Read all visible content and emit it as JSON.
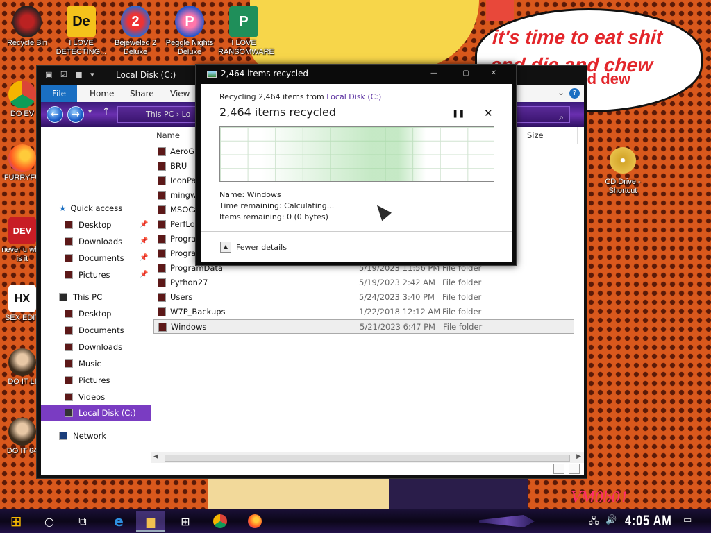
{
  "wallpaper": {
    "speech": "it's time to eat shit and die and chew",
    "speech_overflow": "and dew",
    "watermark": "VM0b01"
  },
  "desktop_icons": [
    {
      "label": "Recycle Bin",
      "icon": "recycle-bin-icon"
    },
    {
      "label": "I LOVE DETECTING...",
      "icon": "app-de-icon"
    },
    {
      "label": "Bejeweled 2 Deluxe",
      "icon": "bejeweled-icon"
    },
    {
      "label": "Peggle Nights Deluxe",
      "icon": "peggle-icon"
    },
    {
      "label": "I LOVE RANSOMWARE",
      "icon": "publisher-icon"
    },
    {
      "label": "DO EV",
      "icon": "chrome-icon"
    },
    {
      "label": "FURRYFU",
      "icon": "firefox-icon"
    },
    {
      "label": "never u why is it",
      "icon": "devcpp-icon"
    },
    {
      "label": "SEX EDIT",
      "icon": "hex-editor-icon"
    },
    {
      "label": "DO IT LI",
      "icon": "portrait-icon"
    },
    {
      "label": "DO IT 64",
      "icon": "portrait-64-icon"
    },
    {
      "label": "CD Drive - Shortcut",
      "icon": "dvd-icon"
    }
  ],
  "explorer": {
    "title": "Local Disk (C:)",
    "ribbon_tabs": [
      "File",
      "Home",
      "Share",
      "View"
    ],
    "help": "?",
    "breadcrumb": "This PC  ›  Lo",
    "nav": {
      "quick_access": "Quick access",
      "quick_items": [
        "Desktop",
        "Downloads",
        "Documents",
        "Pictures"
      ],
      "this_pc": "This PC",
      "pc_items": [
        "Desktop",
        "Documents",
        "Downloads",
        "Music",
        "Pictures",
        "Videos"
      ],
      "selected": "Local Disk (C:)",
      "network": "Network"
    },
    "columns": {
      "name": "Name",
      "size": "Size"
    },
    "files": [
      {
        "name": "AeroGla",
        "date": "",
        "type": ""
      },
      {
        "name": "BRU",
        "date": "",
        "type": ""
      },
      {
        "name": "IconPac",
        "date": "",
        "type": ""
      },
      {
        "name": "mingw6",
        "date": "",
        "type": ""
      },
      {
        "name": "MSOCac",
        "date": "",
        "type": ""
      },
      {
        "name": "PerfLog",
        "date": "",
        "type": ""
      },
      {
        "name": "Progran",
        "date": "",
        "type": ""
      },
      {
        "name": "Progran",
        "date": "",
        "type": ""
      },
      {
        "name": "ProgramData",
        "date": "5/19/2023 11:56 PM",
        "type": "File folder"
      },
      {
        "name": "Python27",
        "date": "5/19/2023 2:42 AM",
        "type": "File folder"
      },
      {
        "name": "Users",
        "date": "5/24/2023 3:40 PM",
        "type": "File folder"
      },
      {
        "name": "W7P_Backups",
        "date": "1/22/2018 12:12 AM",
        "type": "File folder"
      },
      {
        "name": "Windows",
        "date": "5/21/2023 6:47 PM",
        "type": "File folder"
      }
    ]
  },
  "dialog": {
    "title": "2,464 items recycled",
    "line1_prefix": "Recycling 2,464 items from ",
    "line1_link": "Local Disk (C:)",
    "heading": "2,464 items recycled",
    "name": "Name:  Windows",
    "time_remaining": "Time remaining:  Calculating...",
    "items_remaining": "Items remaining:  0 (0 bytes)",
    "fewer_details": "Fewer details",
    "progress": 1.0
  },
  "taskbar": {
    "clock": "4:05 AM"
  },
  "colors": {
    "accent": "#7a3cc2",
    "file_tab": "#1a6fc2",
    "speech_text": "#e3262b"
  }
}
